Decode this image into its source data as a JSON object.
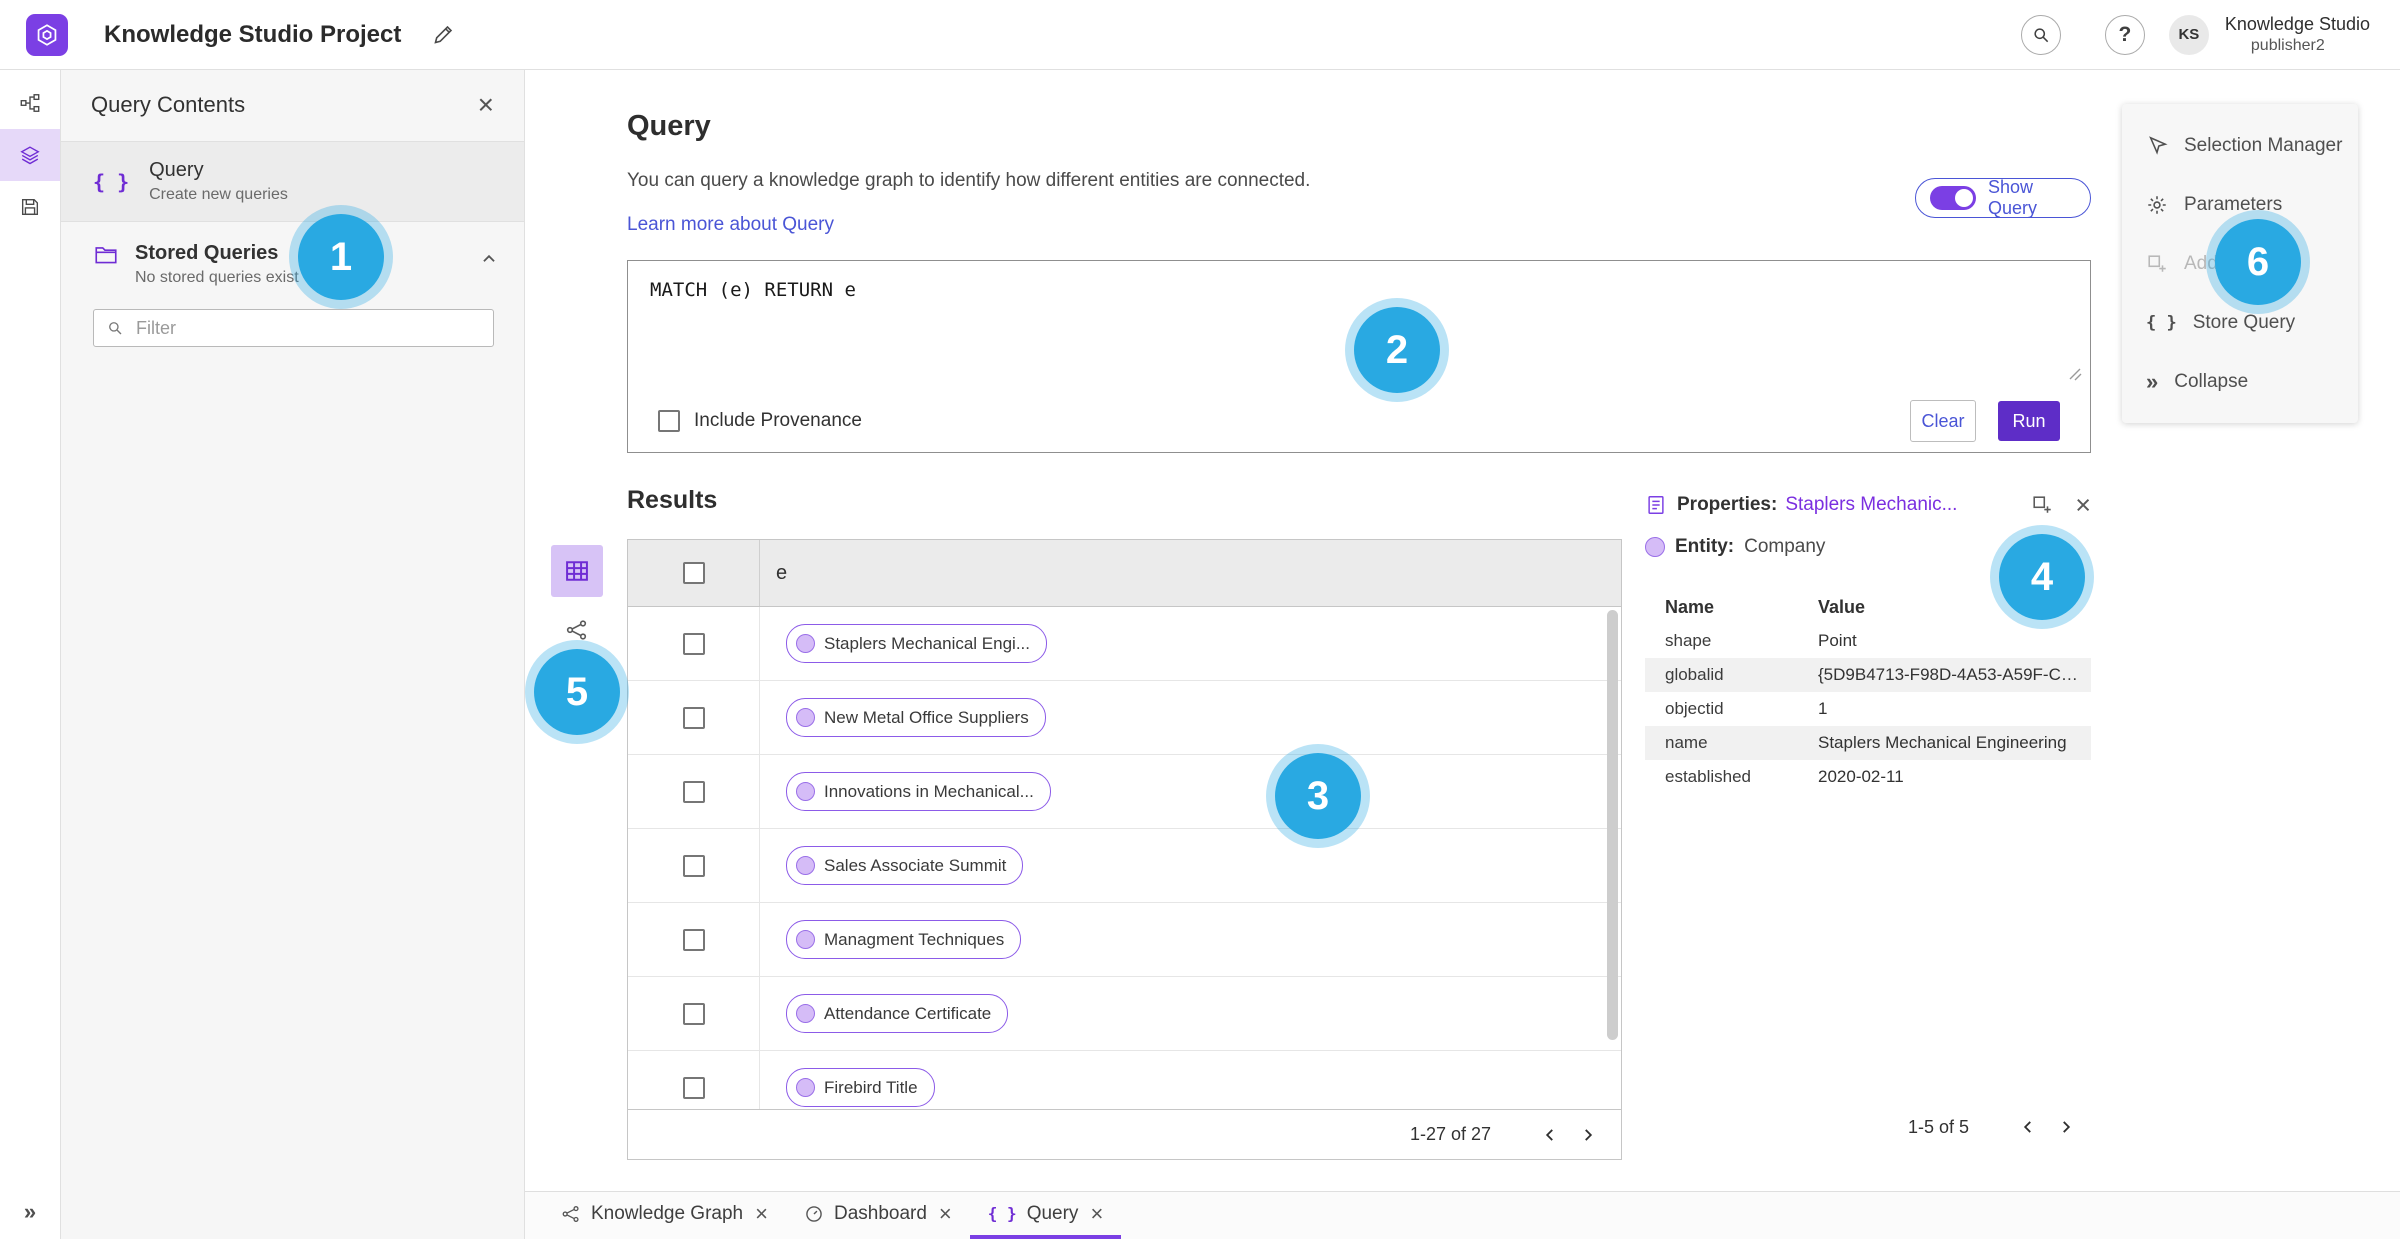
{
  "colors": {
    "accent_purple": "#7B3FE4",
    "button_purple": "#5E2DC7",
    "badge_blue": "#29A9E2",
    "link_blue": "#4A55D6",
    "entity_link_purple": "#7B2FE0"
  },
  "topbar": {
    "title": "Knowledge Studio Project",
    "user_initials": "KS",
    "user_name": "Knowledge Studio",
    "user_role": "publisher2"
  },
  "left_panel": {
    "title": "Query Contents",
    "query_item": {
      "label": "Query",
      "sublabel": "Create new queries"
    },
    "stored_queries": {
      "label": "Stored Queries",
      "sublabel": "No stored queries exist"
    },
    "filter_placeholder": "Filter"
  },
  "query_section": {
    "title": "Query",
    "description": "You can query a knowledge graph to identify how different entities are connected.",
    "learn_more_label": "Learn more about Query",
    "show_query_label": "Show Query",
    "query_text": "MATCH (e) RETURN e",
    "include_provenance_label": "Include Provenance",
    "clear_label": "Clear",
    "run_label": "Run"
  },
  "results": {
    "title": "Results",
    "column_header": "e",
    "rows": [
      "Staplers Mechanical Engi...",
      "New Metal Office Suppliers",
      "Innovations in Mechanical...",
      "Sales Associate Summit",
      "Managment Techniques",
      "Attendance Certificate",
      "Firebird Title"
    ],
    "pagination": "1-27 of 27"
  },
  "properties_panel": {
    "title": "Properties:",
    "entity_link": "Staplers Mechanic...",
    "entity_label": "Entity:",
    "entity_type": "Company",
    "columns": [
      "Name",
      "Value"
    ],
    "rows": [
      {
        "name": "shape",
        "value": "Point"
      },
      {
        "name": "globalid",
        "value": "{5D9B4713-F98D-4A53-A59F-C11..."
      },
      {
        "name": "objectid",
        "value": "1"
      },
      {
        "name": "name",
        "value": "Staplers Mechanical Engineering"
      },
      {
        "name": "established",
        "value": "2020-02-11"
      }
    ],
    "pagination": "1-5 of 5"
  },
  "tools_panel": {
    "items": [
      "Selection Manager",
      "Parameters",
      "Add To Map",
      "Store Query",
      "Collapse"
    ]
  },
  "bottom_tabs": [
    "Knowledge Graph",
    "Dashboard",
    "Query"
  ],
  "badges": [
    "1",
    "2",
    "3",
    "4",
    "5",
    "6"
  ]
}
